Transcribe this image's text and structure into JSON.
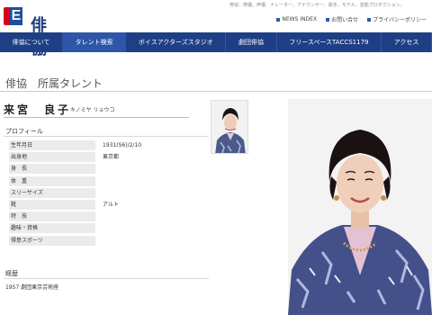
{
  "header": {
    "logo_letter": "E",
    "logo_text": "俳協",
    "tagline": "俳協：俳優、声優、ナレーター、アナウンサー、歌手、モデル、芸能プロダクション。",
    "links": [
      {
        "label": "NEWS INDEX"
      },
      {
        "label": "お問い合せ"
      },
      {
        "label": "プライバシーポリシー"
      }
    ]
  },
  "nav": {
    "items": [
      {
        "label": "俳協について"
      },
      {
        "label": "タレント検索"
      },
      {
        "label": "ボイスアクターズスタジオ"
      },
      {
        "label": "劇団俳協"
      },
      {
        "label": "フリースペースTACCS1179"
      },
      {
        "label": "アクセス"
      }
    ]
  },
  "page": {
    "title": "俳協　所属タレント"
  },
  "talent": {
    "name": "来宮　良子",
    "kana": "キノミヤ リョウコ"
  },
  "profile": {
    "heading": "プロフィール",
    "rows": [
      {
        "label": "生年月日",
        "value": "1931(S6)/2/10"
      },
      {
        "label": "出身地",
        "value": "東京都"
      },
      {
        "label": "身　長",
        "value": ""
      },
      {
        "label": "体　重",
        "value": ""
      },
      {
        "label": "スリーサイズ",
        "value": ""
      },
      {
        "label": "靴",
        "value": "アルト"
      },
      {
        "label": "特　技",
        "value": ""
      },
      {
        "label": "趣味・資格",
        "value": ""
      },
      {
        "label": "得意スポーツ",
        "value": ""
      }
    ]
  },
  "career": {
    "heading": "経歴",
    "text": "1957 劇団東京芸術座"
  },
  "colors": {
    "nav_bg": "#1e3f86",
    "logo_red": "#d9001b",
    "logo_blue": "#1a4f9c"
  }
}
